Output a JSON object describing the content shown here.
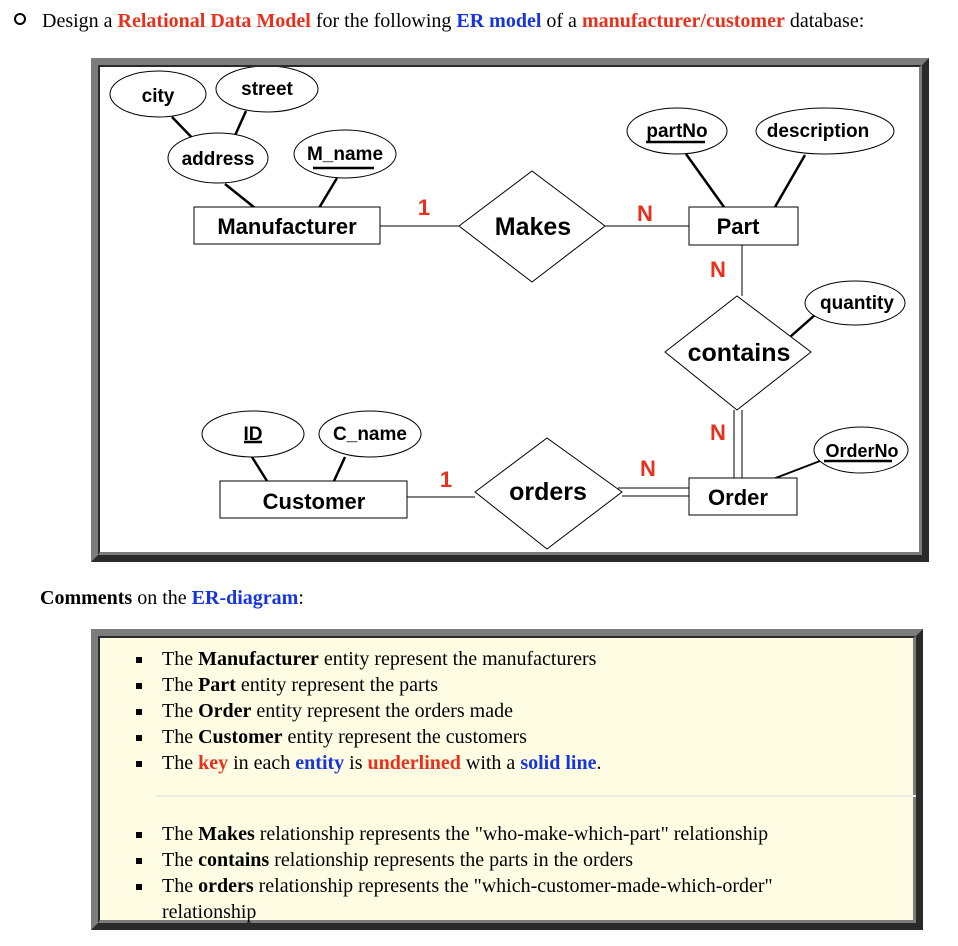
{
  "intro": {
    "bullet_icon": "hollow-circle-bullet",
    "parts": [
      {
        "text": "Design a ",
        "style": "plain"
      },
      {
        "text": "Relational Data Model",
        "style": "red"
      },
      {
        "text": " for the following ",
        "style": "plain"
      },
      {
        "text": "ER model",
        "style": "blue"
      },
      {
        "text": " of a ",
        "style": "plain"
      },
      {
        "text": "manufacturer/customer",
        "style": "red"
      },
      {
        "text": " database:",
        "style": "plain"
      }
    ]
  },
  "diagram": {
    "entities": {
      "manufacturer": "Manufacturer",
      "part": "Part",
      "customer": "Customer",
      "order": "Order"
    },
    "relationships": {
      "makes": "Makes",
      "contains": "contains",
      "orders": "orders"
    },
    "attributes": {
      "city": "city",
      "street": "street",
      "address": "address",
      "m_name": "M_name",
      "partno": "partNo",
      "description": "description",
      "quantity": "quantity",
      "id": "ID",
      "c_name": "C_name",
      "orderno": "OrderNo"
    },
    "cardinalities": {
      "manufacturer_makes": "1",
      "makes_part": "N",
      "part_contains": "N",
      "contains_order": "N",
      "customer_orders": "1",
      "orders_order": "N"
    },
    "colors": {
      "cardinality": "#e8301c"
    }
  },
  "comments": {
    "title_bold": "Comments",
    "title_mid": " on the ",
    "title_link": "ER-diagram",
    "title_end": ":",
    "entity_items": [
      {
        "pre": "The ",
        "bold": "Manufacturer",
        "post": " entity represent the manufacturers"
      },
      {
        "pre": "The ",
        "bold": "Part",
        "post": " entity represent the parts"
      },
      {
        "pre": "The ",
        "bold": "Order",
        "post": " entity represent the orders made"
      },
      {
        "pre": "The ",
        "bold": "Customer",
        "post": " entity represent the customers"
      }
    ],
    "key_item": {
      "t1": "The ",
      "key": "key",
      "t2": " in each ",
      "entity": "entity",
      "t3": " is ",
      "underlined": "underlined",
      "t4": " with a ",
      "solid": "solid line",
      "t5": "."
    },
    "relationship_items": [
      {
        "pre": "The ",
        "bold": "Makes",
        "post": " relationship represents the \"who-make-which-part\" relationship"
      },
      {
        "pre": "The ",
        "bold": "contains",
        "post": " relationship represents the parts in the orders"
      },
      {
        "pre": "The ",
        "bold": "orders",
        "post": " relationship represents the \"which-customer-made-which-order\" relationship"
      }
    ]
  }
}
